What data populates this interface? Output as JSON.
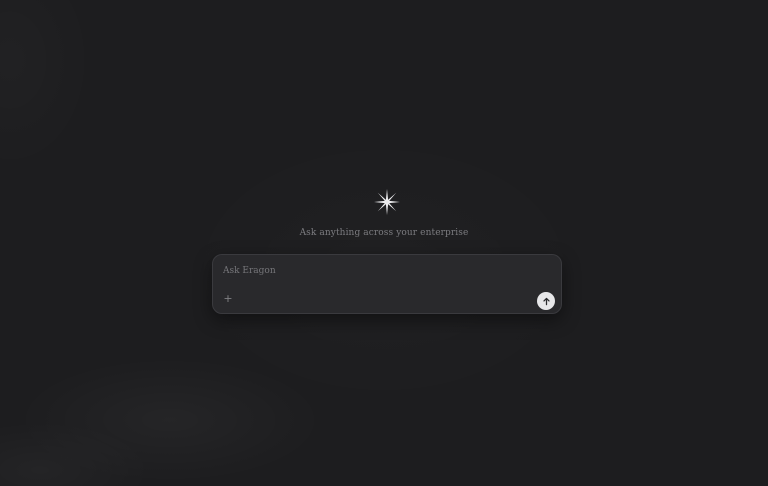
{
  "hero": {
    "tagline": "Ask anything across your enterprise",
    "logo_icon": "sparkle-star-icon"
  },
  "composer": {
    "placeholder": "Ask Eragon",
    "value": "",
    "attach_icon": "plus-icon",
    "attach_glyph": "+",
    "send_icon": "arrow-up-icon"
  },
  "colors": {
    "background": "#1d1d1f",
    "composer_bg": "#29292c",
    "send_button_bg": "#e7e7e9",
    "tagline_text": "#7c7c80"
  }
}
